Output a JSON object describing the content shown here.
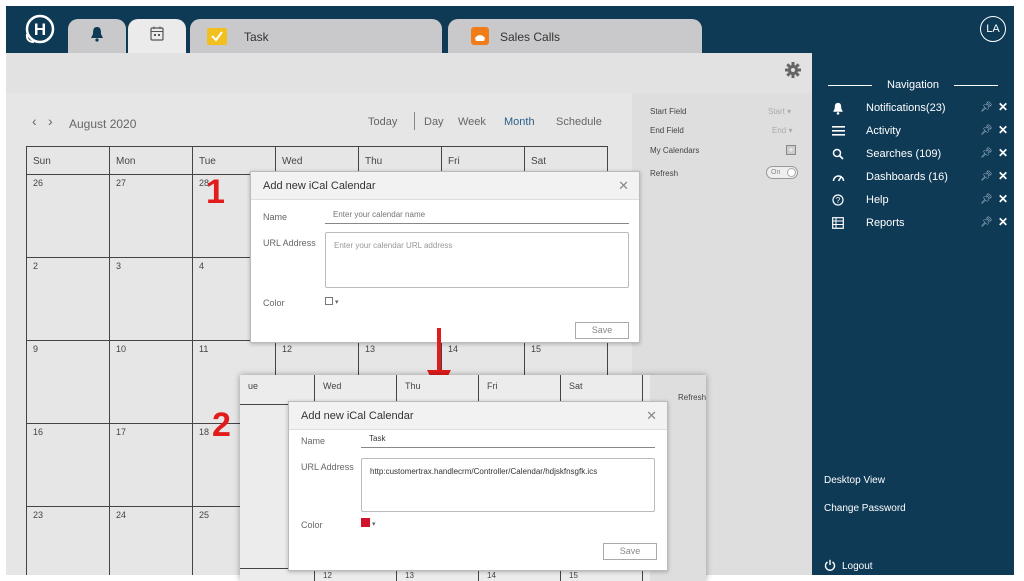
{
  "app": {
    "logo_letter": "H",
    "avatar": "LA"
  },
  "tabs": [
    {
      "icon": "bell-icon"
    },
    {
      "icon": "calendar-icon",
      "active": true
    },
    {
      "icon": "task-icon",
      "label": "Task"
    },
    {
      "icon": "phone-icon",
      "label": "Sales Calls"
    }
  ],
  "calendar": {
    "month_label": "August 2020",
    "today": "Today",
    "views": [
      "Day",
      "Week",
      "Month",
      "Schedule"
    ],
    "active_view": "Month",
    "days": [
      "Sun",
      "Mon",
      "Tue",
      "Wed",
      "Thu",
      "Fri",
      "Sat"
    ],
    "weeks": [
      [
        "26",
        "27",
        "28",
        "",
        "",
        "",
        ""
      ],
      [
        "2",
        "3",
        "4",
        "",
        "",
        "",
        ""
      ],
      [
        "9",
        "10",
        "11",
        "12",
        "13",
        "14",
        "15"
      ],
      [
        "16",
        "17",
        "18",
        "",
        "",
        "",
        ""
      ],
      [
        "23",
        "24",
        "25",
        "",
        "",
        "",
        ""
      ]
    ]
  },
  "settings": {
    "start_field": "Start Field",
    "start_value": "Start",
    "end_field": "End Field",
    "end_value": "End",
    "my_calendars": "My Calendars",
    "refresh": "Refresh",
    "toggle": "On"
  },
  "navigation": {
    "title": "Navigation",
    "items": [
      {
        "label": "Notifications(23)",
        "icon": "bell-icon"
      },
      {
        "label": "Activity",
        "icon": "list-icon"
      },
      {
        "label": "Searches (109)",
        "icon": "search-icon"
      },
      {
        "label": "Dashboards (16)",
        "icon": "gauge-icon"
      },
      {
        "label": "Help",
        "icon": "help-icon"
      },
      {
        "label": "Reports",
        "icon": "table-icon"
      }
    ],
    "desktop_view": "Desktop View",
    "change_password": "Change Password",
    "logout": "Logout"
  },
  "dialog1": {
    "title": "Add new iCal Calendar",
    "name_label": "Name",
    "name_placeholder": "Enter your calendar name",
    "url_label": "URL Address",
    "url_placeholder": "Enter your calendar URL address",
    "color_label": "Color",
    "save": "Save"
  },
  "dialog2": {
    "title": "Add new iCal Calendar",
    "name_label": "Name",
    "name_value": "Task",
    "url_label": "URL Address",
    "url_value": "http:customertrax.handlecrm/Controller/Calendar/hdjskfnsgfk.ics",
    "color_label": "Color",
    "color_value": "#d0132a",
    "save": "Save"
  },
  "panel2": {
    "days": [
      "ue",
      "Wed",
      "Thu",
      "Fri",
      "Sat"
    ],
    "refresh": "Refresh",
    "bottom_dates": [
      "12",
      "13",
      "14",
      "15"
    ]
  },
  "annotations": {
    "step1": "1",
    "step2": "2"
  },
  "colors": {
    "navy": "#0e3a56",
    "accent_red": "#e21c1c",
    "link_blue": "#2d5f8a"
  }
}
